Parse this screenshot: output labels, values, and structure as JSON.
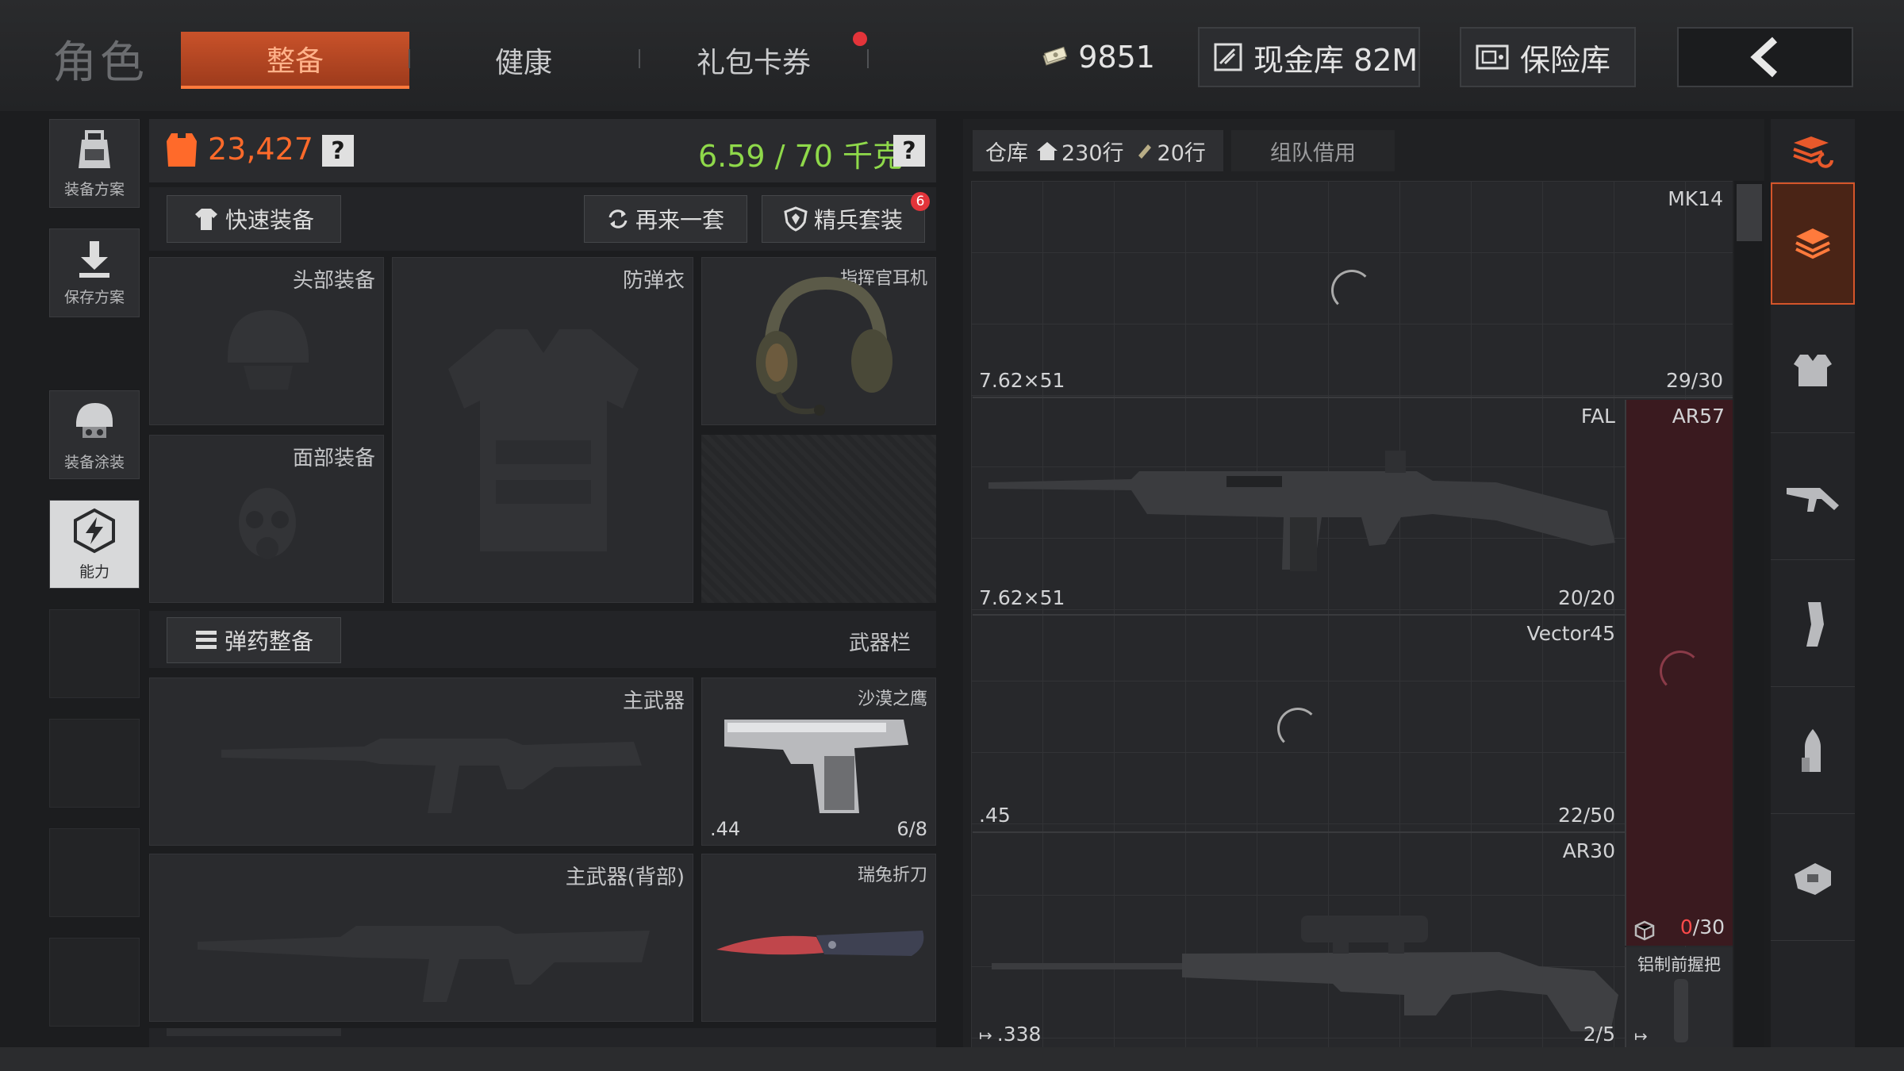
{
  "header": {
    "role_title": "角色",
    "tabs": [
      {
        "label": "整备",
        "active": true
      },
      {
        "label": "健康",
        "active": false
      },
      {
        "label": "礼包卡券",
        "active": false
      }
    ],
    "coins": "9851",
    "cash_vault": "现金库 82M",
    "safe_vault": "保险库",
    "back_icon": "chevron-left-icon"
  },
  "sidebar": {
    "items": [
      {
        "label": "装备方案",
        "icon": "backpack-icon"
      },
      {
        "label": "保存方案",
        "icon": "download-icon"
      },
      {
        "label": "装备涂装",
        "icon": "helmet-paint-icon"
      },
      {
        "label": "能力",
        "icon": "ability-icon",
        "active": true
      }
    ]
  },
  "loadout": {
    "value": "23,427",
    "weight": "6.59 / 70 千克",
    "help": "?",
    "quick_equip": "快速装备",
    "again": "再来一套",
    "elite_set": "精兵套装",
    "elite_badge": "6",
    "slots": {
      "head": "头部装备",
      "face": "面部装备",
      "armor": "防弹衣",
      "headset": "指挥官耳机"
    },
    "ammo_button": "弹药整备",
    "weapon_bar": "武器栏",
    "primary": "主武器",
    "primary_back": "主武器(背部)",
    "pistol": {
      "name": "沙漠之鹰",
      "caliber": ".44",
      "ammo": "6/8"
    },
    "knife": {
      "name": "瑞兔折刀"
    }
  },
  "storage": {
    "tab_label": "仓库",
    "rows_home": "230行",
    "rows_extra": "20行",
    "team_borrow": "组队借用",
    "items": [
      {
        "name": "MK14",
        "caliber": "7.62×51",
        "ammo": "29/30"
      },
      {
        "name": "FAL",
        "caliber": "7.62×51",
        "ammo": "20/20"
      },
      {
        "name": "Vector45",
        "caliber": ".45",
        "ammo": "22/50"
      },
      {
        "name": "AR30",
        "caliber": ".338",
        "ammo": "2/5"
      }
    ],
    "side_items": [
      {
        "name": "AR57"
      },
      {
        "ammo_zero": "0",
        "ammo_rest": "/30"
      },
      {
        "name": "铝制前握把"
      }
    ]
  },
  "categories": [
    "stack-refresh-icon",
    "stack-icon",
    "armor-icon",
    "rifle-icon",
    "magazine-icon",
    "bullet-icon",
    "glove-icon"
  ],
  "colors": {
    "accent": "#d4552a",
    "value_orange": "#ff6a2a",
    "weight_green": "#8fd94a",
    "side_red": "#3e1a20"
  }
}
